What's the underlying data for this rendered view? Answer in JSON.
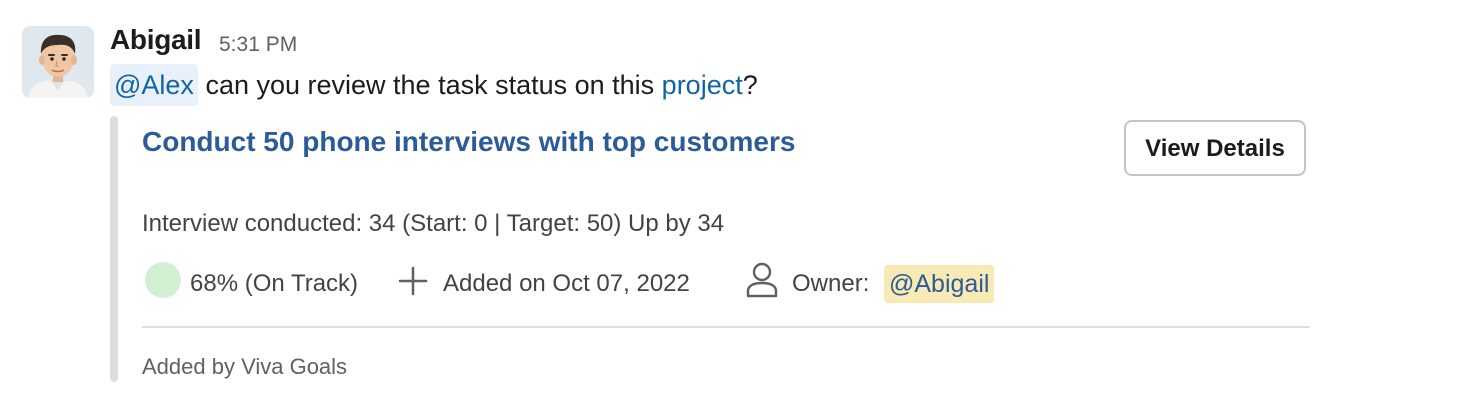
{
  "message": {
    "author": "Abigail",
    "time": "5:31 PM",
    "mention": "@Alex",
    "text_before_link": " can you review the task status on this ",
    "link_text": "project",
    "text_after_link": "?"
  },
  "card": {
    "title": "Conduct 50 phone interviews with top customers",
    "view_button": "View Details",
    "detail": "Interview conducted: 34 (Start: 0 | Target: 50) Up by 34",
    "progress_text": "68% (On Track)",
    "added_text": "Added on Oct 07, 2022",
    "owner_label": "Owner:",
    "owner_mention": "@Abigail",
    "footer": "Added by Viva Goals"
  },
  "icons": {
    "avatar": "user-avatar",
    "progress": "status-dot-icon",
    "added": "plus-icon",
    "owner": "person-icon"
  },
  "colors": {
    "link": "#1264a3",
    "card_title": "#2c5c97",
    "mention_bg": "#e8f1fa",
    "owner_mention_bg": "#f9e9b5",
    "progress_dot": "#d3efd2",
    "attachment_bar": "#dddddd"
  }
}
